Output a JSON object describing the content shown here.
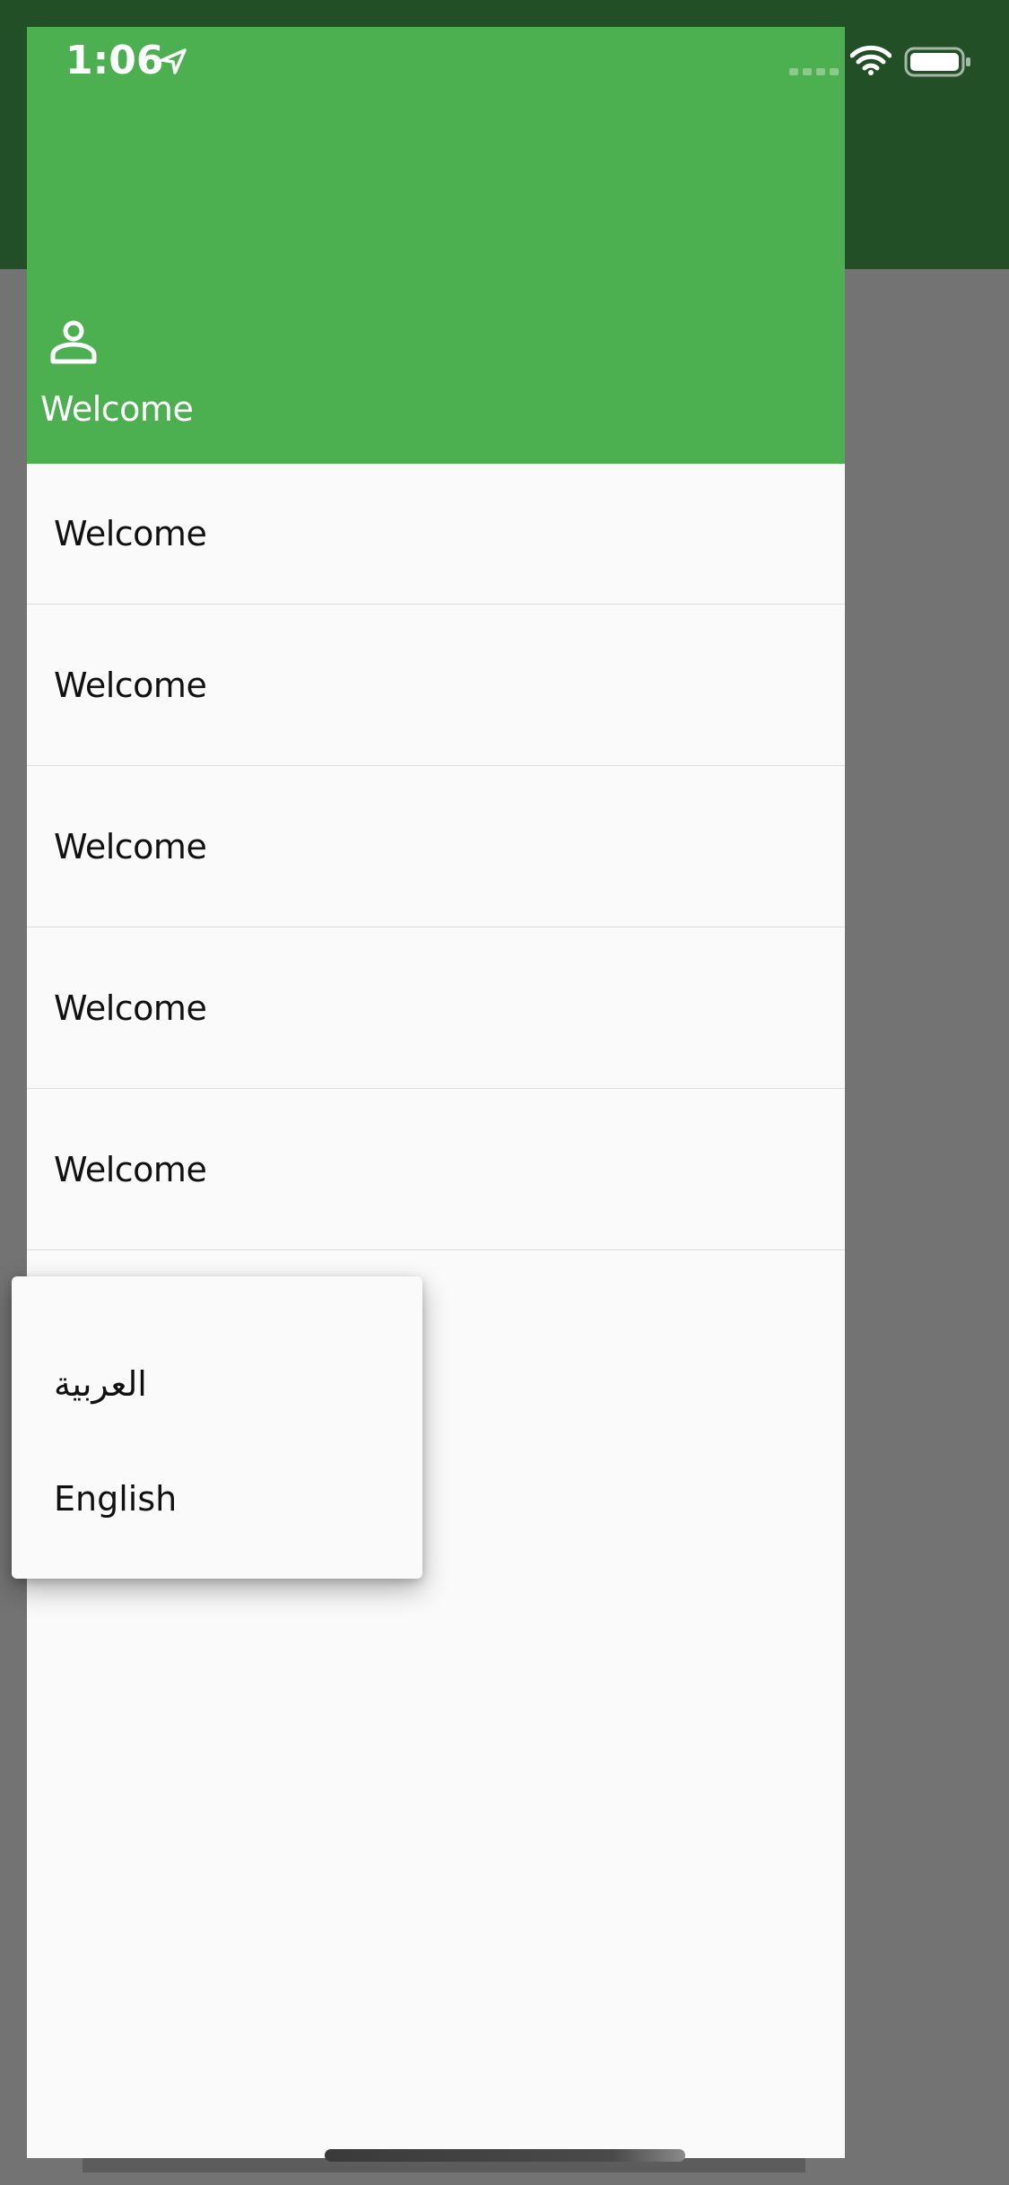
{
  "status_bar": {
    "time": "1:06",
    "icons": [
      "location-arrow-icon",
      "signal-icon",
      "wifi-icon",
      "battery-icon"
    ]
  },
  "drawer": {
    "header": {
      "icon": "person-outline-icon",
      "title": "Welcome"
    },
    "items": [
      {
        "label": "Welcome"
      },
      {
        "label": "Welcome"
      },
      {
        "label": "Welcome"
      },
      {
        "label": "Welcome"
      },
      {
        "label": "Welcome"
      }
    ]
  },
  "language_menu": {
    "options": [
      {
        "label": "العربية"
      },
      {
        "label": "English"
      }
    ]
  },
  "colors": {
    "primary": "#4caf50",
    "app_bar_dimmed": "#224f25",
    "scrim": "#737373",
    "drawer_background": "#fafafa"
  }
}
